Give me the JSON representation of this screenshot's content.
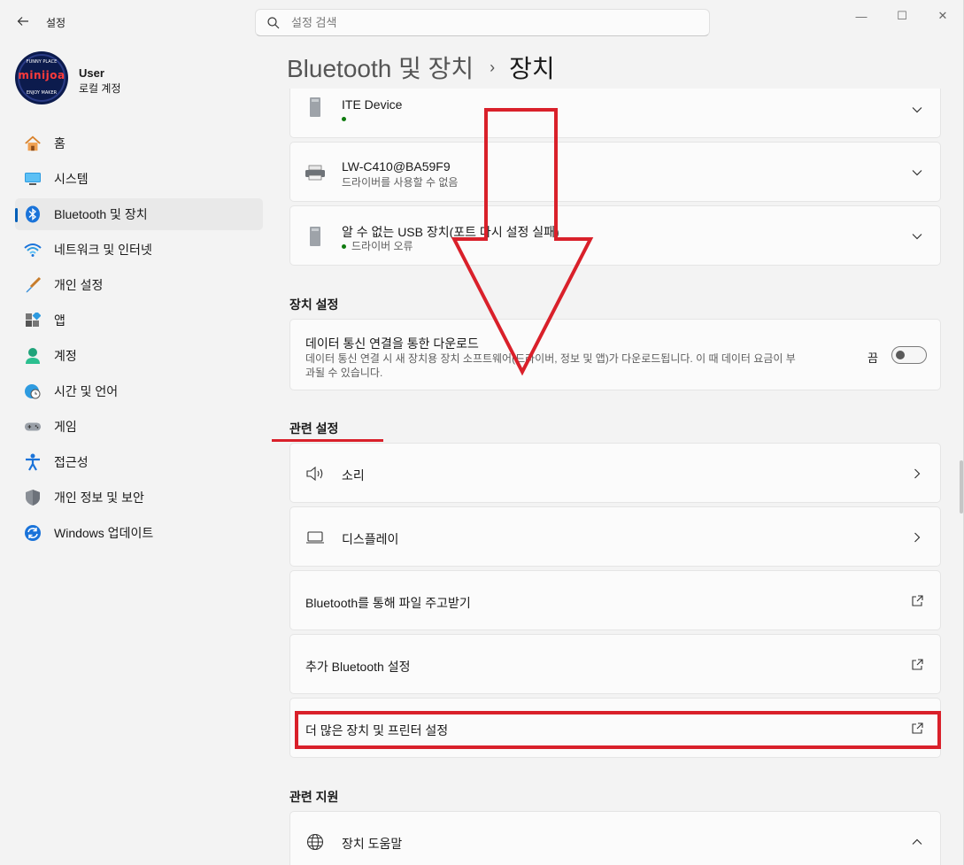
{
  "window": {
    "app_title": "설정",
    "min_glyph": "—",
    "max_glyph": "☐",
    "close_glyph": "✕"
  },
  "search": {
    "placeholder": "설정 검색"
  },
  "profile": {
    "name": "User",
    "subtitle": "로컬 계정",
    "avatar_text": "minijoa",
    "avatar_top_text": "FUNNY PLACE",
    "avatar_bottom_text": "ENJOY MAKER"
  },
  "sidebar": {
    "items": [
      {
        "label": "홈",
        "icon": "home-icon"
      },
      {
        "label": "시스템",
        "icon": "system-icon"
      },
      {
        "label": "Bluetooth 및 장치",
        "icon": "bluetooth-icon",
        "selected": true
      },
      {
        "label": "네트워크 및 인터넷",
        "icon": "wifi-icon"
      },
      {
        "label": "개인 설정",
        "icon": "brush-icon"
      },
      {
        "label": "앱",
        "icon": "apps-icon"
      },
      {
        "label": "계정",
        "icon": "account-icon"
      },
      {
        "label": "시간 및 언어",
        "icon": "clock-globe-icon"
      },
      {
        "label": "게임",
        "icon": "gamepad-icon"
      },
      {
        "label": "접근성",
        "icon": "accessibility-icon"
      },
      {
        "label": "개인 정보 및 보안",
        "icon": "shield-icon"
      },
      {
        "label": "Windows 업데이트",
        "icon": "update-icon"
      }
    ]
  },
  "breadcrumb": {
    "parent": "Bluetooth 및 장치",
    "separator": "›",
    "current": "장치"
  },
  "devices": [
    {
      "name": "ITE Device",
      "status": ""
    },
    {
      "name": "LW-C410@BA59F9",
      "status": "드라이버를 사용할 수 없음"
    },
    {
      "name": "알 수 없는 USB 장치(포트 다시 설정 실패)",
      "status": "드라이버 오류"
    }
  ],
  "device_settings": {
    "heading": "장치 설정",
    "metered": {
      "title": "데이터 통신 연결을 통한 다운로드",
      "desc_line1": "데이터 통신 연결 시 새 장치용 장치 소프트웨어(드라이버, 정보 및 앱)가 다운로드됩니다. 이 때 데이터 요금이 부",
      "desc_line2": "과될 수 있습니다.",
      "toggle_label": "끔",
      "toggle_on": false
    }
  },
  "related_settings": {
    "heading": "관련 설정",
    "items": [
      {
        "label": "소리"
      },
      {
        "label": "디스플레이"
      },
      {
        "label": "Bluetooth를 통해 파일 주고받기"
      },
      {
        "label": "추가 Bluetooth 설정"
      },
      {
        "label": "더 많은 장치 및 프린터 설정"
      }
    ]
  },
  "related_support": {
    "heading": "관련 지원",
    "items": [
      {
        "label": "장치 도움말"
      }
    ]
  },
  "colors": {
    "accent": "#005fb8",
    "annotation_red": "#d9202a",
    "status_green": "#0f7b0f"
  }
}
